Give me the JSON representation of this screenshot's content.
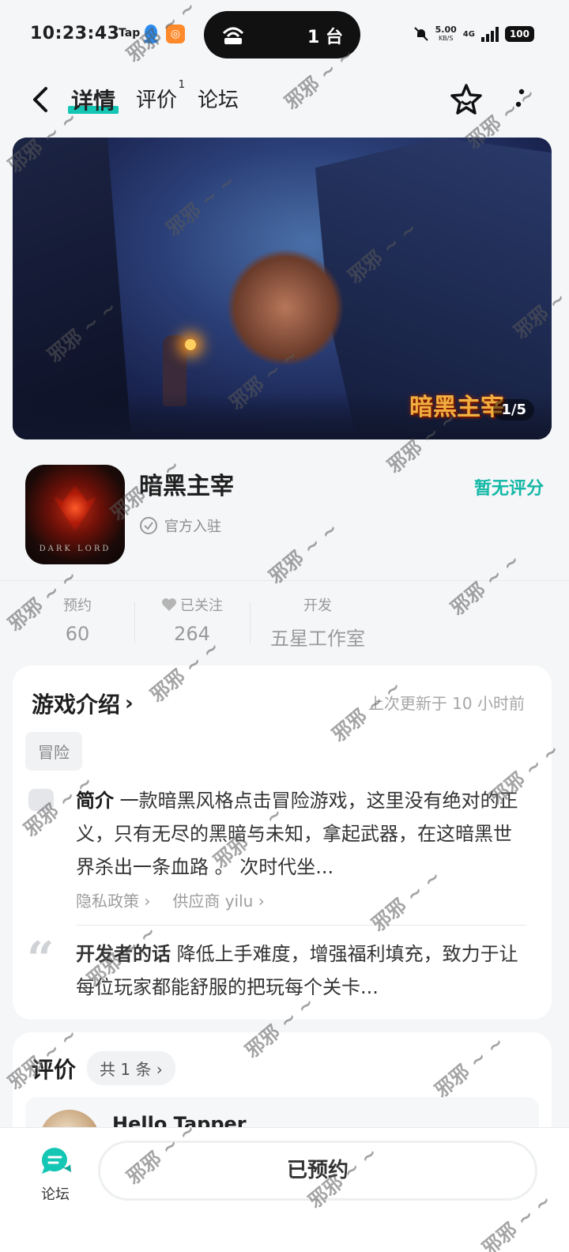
{
  "status_bar": {
    "time": "10:23:43",
    "tap_label": "Tap",
    "island_count": "1 台",
    "net_speed": "5.00",
    "net_unit": "KB/S",
    "network": "4G",
    "battery": "100"
  },
  "header": {
    "tabs": [
      {
        "label": "详情",
        "active": true
      },
      {
        "label": "评价",
        "badge": "1"
      },
      {
        "label": "论坛"
      }
    ]
  },
  "banner": {
    "logo_text": "暗黑主宰",
    "pager": "1/5"
  },
  "game": {
    "name": "暗黑主宰",
    "icon_text": "DARK LORD",
    "badge": "官方入驻",
    "rating": "暂无评分"
  },
  "stats": [
    {
      "label": "预约",
      "value": "60"
    },
    {
      "label": "已关注",
      "value": "264"
    },
    {
      "label": "开发",
      "value": "五星工作室"
    }
  ],
  "intro": {
    "title": "游戏介绍",
    "updated": "上次更新于 10 小时前",
    "tag": "冒险",
    "summary_label": "简介",
    "summary": "一款暗黑风格点击冒险游戏，这里没有绝对的正义，只有无尽的黑暗与未知，拿起武器，在这暗黑世界杀出一条血路 。 次时代坐...",
    "privacy_link": "隐私政策 ›",
    "supplier_link": "供应商 yilu ›",
    "dev_label": "开发者的话",
    "dev_words": "降低上手难度，增强福利填充，致力于让每位玩家都能舒服的把玩每个关卡..."
  },
  "reviews": {
    "title": "评价",
    "count": "共 1 条 ›",
    "first_user": "Hello Tapper"
  },
  "bottom": {
    "forum_label": "论坛",
    "reserve_button": "已预约"
  },
  "watermark": "邪邪 ~ ~"
}
